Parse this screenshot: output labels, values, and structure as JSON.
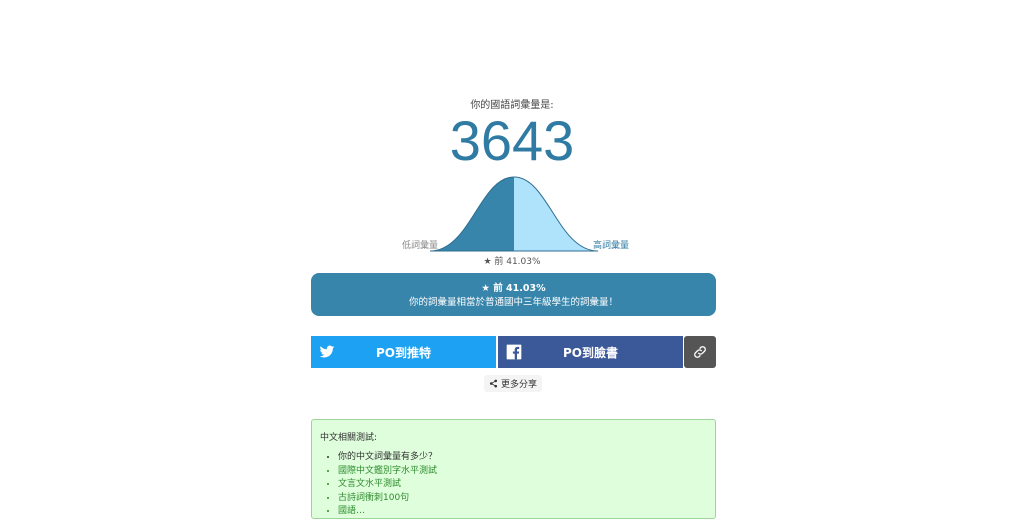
{
  "result": {
    "intro": "你的國語詞彙量是:",
    "score": "3643",
    "low_label": "低詞彙量",
    "high_label": "高詞彙量",
    "rank_marker": "★ 前 41.03%",
    "percentile": 41.03,
    "summary_rank": "★ 前 41.03%",
    "summary_text": "你的詞彙量相當於普通國中三年級學生的詞彙量！"
  },
  "share": {
    "twitter_label": "PO到推特",
    "facebook_label": "PO到臉書",
    "more_label": "更多分享"
  },
  "tests": {
    "title": "中文相關測試:",
    "items": [
      "你的中文詞彙量有多少？",
      "國際中文鑑別字水平測試",
      "文言文水平測試",
      "古詩詞衝刺100句",
      "國語…"
    ]
  },
  "colors": {
    "accent": "#2f7ba3",
    "curve_fill": "#3785ab",
    "curve_light": "#aee3fb",
    "twitter": "#1da1f2",
    "facebook": "#3b5998",
    "link_button": "#555555",
    "tests_bg": "#dfffdc"
  }
}
